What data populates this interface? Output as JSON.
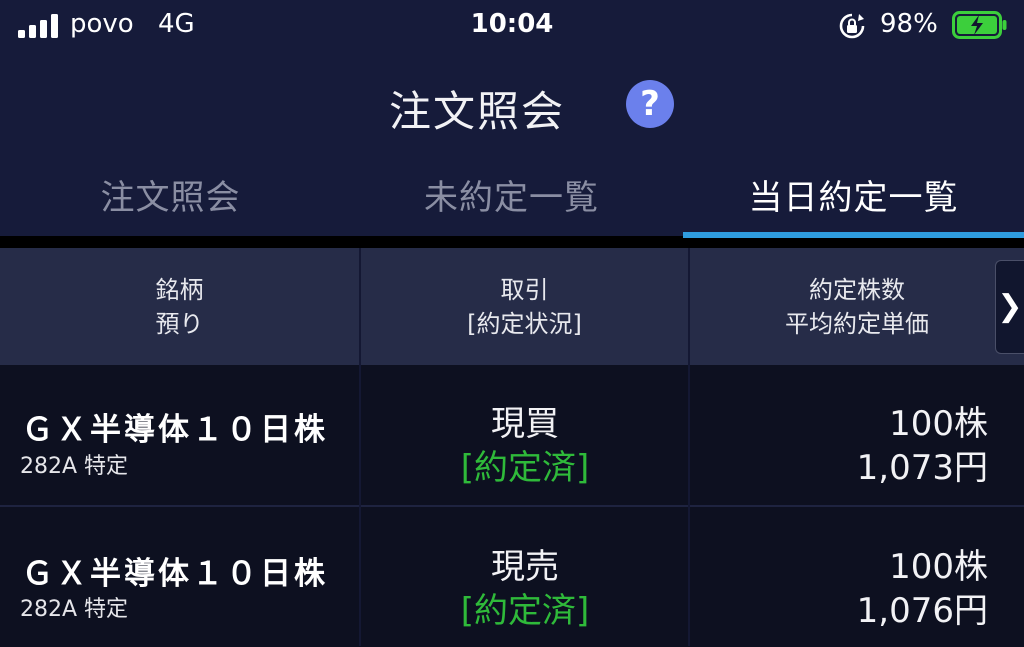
{
  "status_bar": {
    "carrier": "povo",
    "network": "4G",
    "time": "10:04",
    "battery_percent": "98%",
    "icons": [
      "signal-icon",
      "rotation-lock-icon",
      "battery-charging-icon"
    ]
  },
  "header": {
    "title": "注文照会",
    "help_icon": "?"
  },
  "tabs": [
    {
      "label": "注文照会",
      "active": false
    },
    {
      "label": "未約定一覧",
      "active": false
    },
    {
      "label": "当日約定一覧",
      "active": true
    }
  ],
  "table": {
    "columns": [
      {
        "line1": "銘柄",
        "line2": "預り"
      },
      {
        "line1": "取引",
        "line2": "[約定状況]"
      },
      {
        "line1": "約定株数",
        "line2": "平均約定単価"
      }
    ],
    "scroll_arrow": "❯",
    "rows": [
      {
        "name": "ＧＸ半導体１０日株",
        "sub": "282A 特定",
        "trade": "現買",
        "status": "[約定済]",
        "quantity": "100株",
        "price": "1,073円"
      },
      {
        "name": "ＧＸ半導体１０日株",
        "sub": "282A 特定",
        "trade": "現売",
        "status": "[約定済]",
        "quantity": "100株",
        "price": "1,076円"
      }
    ]
  },
  "colors": {
    "background": "#11162e",
    "header_bg": "#161b3a",
    "table_header_bg": "#262c48",
    "row_bg": "#0d1020",
    "accent_blue": "#2f9de0",
    "help_icon": "#6b80ec",
    "status_green": "#2fba3a",
    "battery_green": "#3ccf3c"
  }
}
